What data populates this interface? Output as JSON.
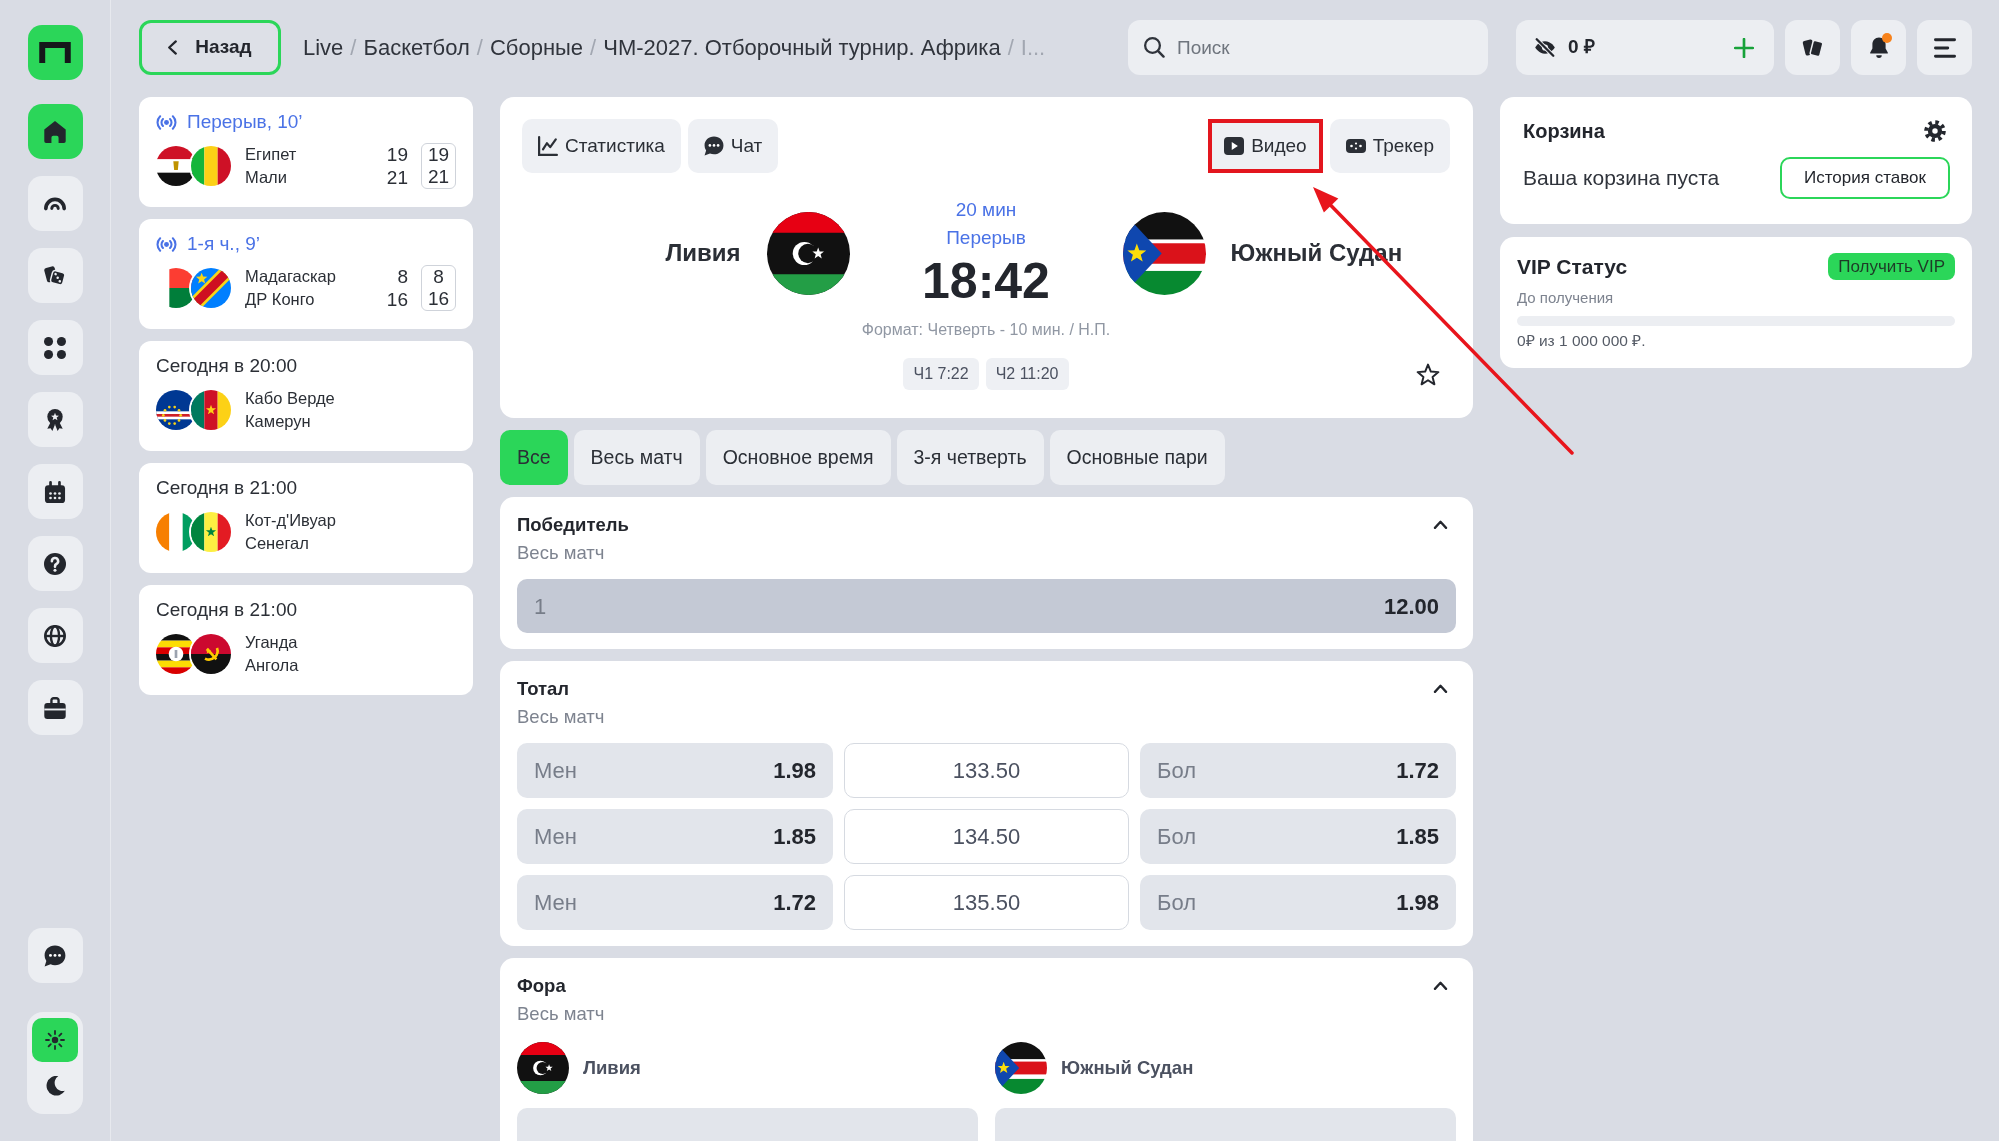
{
  "sidebar": {
    "items": [
      {
        "kind": "house",
        "selected": true
      },
      {
        "kind": "arch",
        "selected": false
      },
      {
        "kind": "dice",
        "selected": false
      },
      {
        "kind": "dots",
        "selected": false
      },
      {
        "kind": "award",
        "selected": false
      },
      {
        "kind": "calendar",
        "selected": false
      },
      {
        "kind": "question",
        "selected": false
      },
      {
        "kind": "globe",
        "selected": false
      },
      {
        "kind": "briefcase",
        "selected": false
      }
    ],
    "theme_switch": [
      {
        "kind": "sun",
        "selected": true
      },
      {
        "kind": "moon",
        "selected": false
      }
    ]
  },
  "top_bar": {
    "back_button": "Назад",
    "breadcrumb": {
      "separator": "/",
      "items": [
        "Live",
        "Баскетбол",
        "Сборные",
        "ЧМ-2027. Отборочный турнир. Африка",
        "I..."
      ]
    },
    "search": {
      "placeholder": "Поиск"
    },
    "balance": "0 ₽",
    "notifications": {
      "unread": true
    }
  },
  "match_list": [
    {
      "kind": "live",
      "status": "Перерыв, 10’",
      "teams": [
        {
          "name": "Египет",
          "scores": [
            "19",
            "19"
          ]
        },
        {
          "name": "Мали",
          "scores": [
            "21",
            "21"
          ]
        }
      ]
    },
    {
      "kind": "live",
      "status": "1-я ч., 9’",
      "teams": [
        {
          "name": "Мадагаскар",
          "scores": [
            "8",
            "8"
          ]
        },
        {
          "name": "ДР Конго",
          "scores": [
            "16",
            "16"
          ]
        }
      ]
    },
    {
      "kind": "upcoming",
      "start": "Сегодня в 20:00",
      "teams": [
        {
          "name": "Кабо Верде"
        },
        {
          "name": "Камерун"
        }
      ]
    },
    {
      "kind": "upcoming",
      "start": "Сегодня в 21:00",
      "teams": [
        {
          "name": "Кот-д'Ивуар"
        },
        {
          "name": "Сенегал"
        }
      ]
    },
    {
      "kind": "upcoming",
      "start": "Сегодня в 21:00",
      "teams": [
        {
          "name": "Уганда"
        },
        {
          "name": "Ангола"
        }
      ]
    }
  ],
  "match": {
    "left_actions": [
      {
        "kind": "stats",
        "label": "Статистика",
        "highlighted": false
      },
      {
        "kind": "chat",
        "label": "Чат",
        "highlighted": false
      }
    ],
    "right_actions": [
      {
        "kind": "video",
        "label": "Видео",
        "highlighted": true
      },
      {
        "kind": "tracker",
        "label": "Трекер",
        "highlighted": false
      }
    ],
    "home": {
      "name": "Ливия"
    },
    "away": {
      "name": "Южный Судан"
    },
    "minute": "20 мин",
    "phase": "Перерыв",
    "time": "18:42",
    "format": "Формат: Четверть - 10 мин. / Н.П.",
    "periods": [
      "Ч1 7:22",
      "Ч2 11:20"
    ],
    "favorite": false
  },
  "market_filters": [
    {
      "label": "Все",
      "selected": true
    },
    {
      "label": "Весь матч",
      "selected": false
    },
    {
      "label": "Основное время",
      "selected": false
    },
    {
      "label": "3-я четверть",
      "selected": false
    },
    {
      "label": "Основные пари",
      "selected": false
    }
  ],
  "markets": [
    {
      "kind": "single",
      "title": "Победитель",
      "subtitle": "Весь матч",
      "expanded": true,
      "outcomes": [
        {
          "label": "1",
          "odds": "12.00",
          "highlighted": true
        }
      ]
    },
    {
      "kind": "lines",
      "title": "Тотал",
      "subtitle": "Весь матч",
      "expanded": true,
      "rows": [
        {
          "under": {
            "label": "Мен",
            "odds": "1.98",
            "highlighted": false
          },
          "line": "133.50",
          "over": {
            "label": "Бол",
            "odds": "1.72",
            "highlighted": false
          }
        },
        {
          "under": {
            "label": "Мен",
            "odds": "1.85",
            "highlighted": false
          },
          "line": "134.50",
          "over": {
            "label": "Бол",
            "odds": "1.85",
            "highlighted": false
          }
        },
        {
          "under": {
            "label": "Мен",
            "odds": "1.72",
            "highlighted": false
          },
          "line": "135.50",
          "over": {
            "label": "Бол",
            "odds": "1.98",
            "highlighted": false
          }
        }
      ]
    },
    {
      "kind": "handicap",
      "title": "Фора",
      "subtitle": "Весь матч",
      "expanded": true,
      "teams": [
        {
          "name": "Ливия"
        },
        {
          "name": "Южный Судан"
        }
      ],
      "rows": [
        {
          "home": {
            "highlighted": false
          },
          "away": {
            "highlighted": false
          }
        }
      ]
    }
  ],
  "bet_slip": {
    "title": "Корзина",
    "empty_text": "Ваша корзина пуста",
    "history_button": "История ставок"
  },
  "vip": {
    "title": "VIP Статус",
    "button": "Получить VIP",
    "caption": "До получения",
    "level": 0,
    "progress_text": "0₽ из 1 000 000 ₽."
  },
  "annotation": {
    "kind": "arrow"
  }
}
